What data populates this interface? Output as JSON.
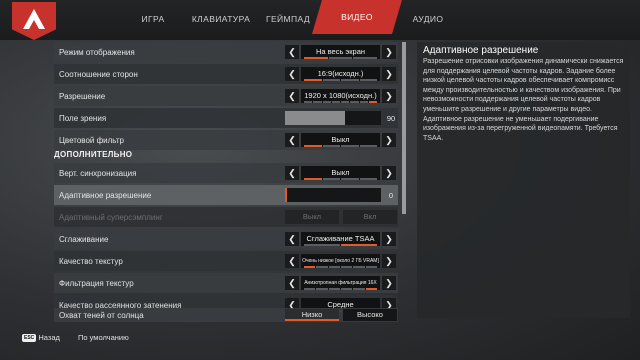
{
  "tabs": [
    {
      "label": "ИГРА",
      "active": false
    },
    {
      "label": "КЛАВИАТУРА",
      "active": false
    },
    {
      "label": "ГЕЙМПАД",
      "active": false
    },
    {
      "label": "ВИДЕО",
      "active": true
    },
    {
      "label": "АУДИО",
      "active": false
    }
  ],
  "settings": {
    "display_mode": {
      "label": "Режим отображения",
      "value": "На весь экран"
    },
    "aspect_ratio": {
      "label": "Соотношение сторон",
      "value": "16:9(исходн.)"
    },
    "resolution": {
      "label": "Разрешение",
      "value": "1920 x 1080(исходн.)"
    },
    "fov": {
      "label": "Поле зрения",
      "value": "90",
      "level": 0.62
    },
    "color_filter": {
      "label": "Цветовой фильтр",
      "value": "Выкл"
    },
    "advanced_title": "ДОПОЛНИТЕЛЬНО",
    "vsync": {
      "label": "Верт. синхронизация",
      "value": "Выкл"
    },
    "adaptive_res": {
      "label": "Адаптивное разрешение",
      "value": "0",
      "level": 0.0
    },
    "adaptive_ss": {
      "label": "Адаптивный суперсэмплинг",
      "off": "Выкл",
      "on": "Вкл"
    },
    "antialiasing": {
      "label": "Сглаживание",
      "value": "Сглаживание TSAA"
    },
    "texture_quality": {
      "label": "Качество текстур",
      "value": "Очень низкое [около 2 ГБ VRAM]"
    },
    "texture_filtering": {
      "label": "Фильтрация текстур",
      "value": "Анизотропная фильтрация 16Х"
    },
    "ambient_occlusion": {
      "label": "Качество рассеянного затенения",
      "value": "Средне"
    },
    "sun_shadows": {
      "label": "Охват теней от солнца",
      "low": "Низко",
      "high": "Высоко"
    }
  },
  "info": {
    "title": "Адаптивное разрешение",
    "text": "Разрешение отрисовки изображения динамически снижается для поддержания целевой частоты кадров. Задание более низкой целевой частоты кадров обеспечивает компромисс между производительностью и качеством изображения. При невозможности поддержания целевой частоты кадров уменьшите разрешение и другие параметры видео. Адаптивное разрешение не уменьшает подергивание изображения из-за перегруженной видеопамяти. Требуется TSAA."
  },
  "bottom": {
    "esc_key": "ESC",
    "back_label": "Назад",
    "defaults_label": "По умолчанию"
  },
  "colors": {
    "accent": "#c8322c",
    "highlight": "#e05a2b"
  }
}
